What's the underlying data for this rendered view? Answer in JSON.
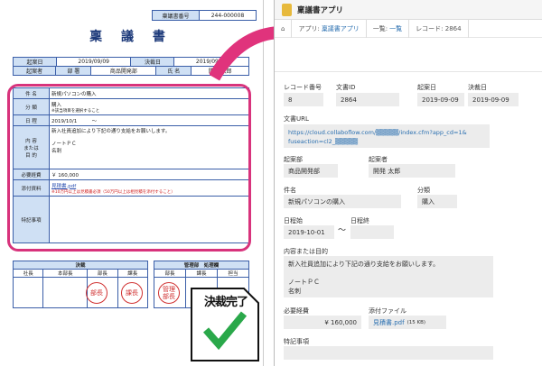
{
  "doc": {
    "num_label": "稟議書番号",
    "num": "244-000008",
    "title": "稟 議 書",
    "row1": [
      "起案日",
      "2019/09/09",
      "決裁日",
      "2019/09/09"
    ],
    "row2": [
      "起案者",
      "部 署",
      "商品開発部",
      "氏 名",
      "開発 太郎"
    ],
    "fields": [
      {
        "k": "件 名",
        "v": "新規パソコンの購入"
      },
      {
        "k": "分 類",
        "v": "購入",
        "sub": "※該当項目を選択すること"
      },
      {
        "k": "日 程",
        "v": "2019/10/1　　　〜"
      },
      {
        "k": "内 容\nまたは\n目 的",
        "v": "新入社員追加により下記の通り支給をお願いします。\n\nノートＰＣ\n名刺"
      },
      {
        "k": "必要経費",
        "v": "￥ 160,000"
      },
      {
        "k": "添付資料",
        "v": "見積書.pdf",
        "sub": "※10万円以上は見積書必須（50万円以上は相見積を添付すること）"
      },
      {
        "k": "特記事項",
        "v": ""
      }
    ],
    "approval_title": "決裁",
    "approval_cols": [
      "社長",
      "本部長",
      "部長",
      "課長"
    ],
    "admin_title": "管理部　処理欄",
    "admin_cols": [
      "部長",
      "課長",
      "担当"
    ],
    "stamps": [
      "部長",
      "課長",
      "管理\n部長"
    ],
    "done_badge": "決裁完了"
  },
  "app": {
    "title": "稟議書アプリ",
    "crumbs": [
      "アプリ:",
      "稟議書アプリ",
      "一覧:",
      "一覧",
      "レコード: 2864"
    ],
    "record_no_label": "レコード番号",
    "record_no": "8",
    "doc_id_label": "文書ID",
    "doc_id": "2864",
    "draft_date_label": "起案日",
    "draft_date": "2019-09-09",
    "decide_date_label": "決裁日",
    "decide_date": "2019-09-09",
    "url_label": "文書URL",
    "url": "https://cloud.collaboflow.com/▒▒▒▒▒/index.cfm?app_cd=1&\nfuseaction=cl2_▒▒▒▒▒",
    "dept_label": "起案部",
    "dept": "商品開発部",
    "author_label": "起案者",
    "author": "開発 太郎",
    "subject_label": "件名",
    "subject": "新規パソコンの購入",
    "category_label": "分類",
    "category": "購入",
    "start_label": "日程始",
    "start": "2019-10-01",
    "tilde": "〜",
    "end_label": "日程終",
    "end": "",
    "content_label": "内容または目的",
    "content": "新入社員追加により下記の通り支給をお願いします。\n\nノートＰＣ\n名刺",
    "cost_label": "必要経費",
    "cost": "¥ 160,000",
    "attach_label": "添付ファイル",
    "attach": "見積書.pdf",
    "attach_size": "(15 KB)",
    "notes_label": "特記事項",
    "notes": ""
  }
}
